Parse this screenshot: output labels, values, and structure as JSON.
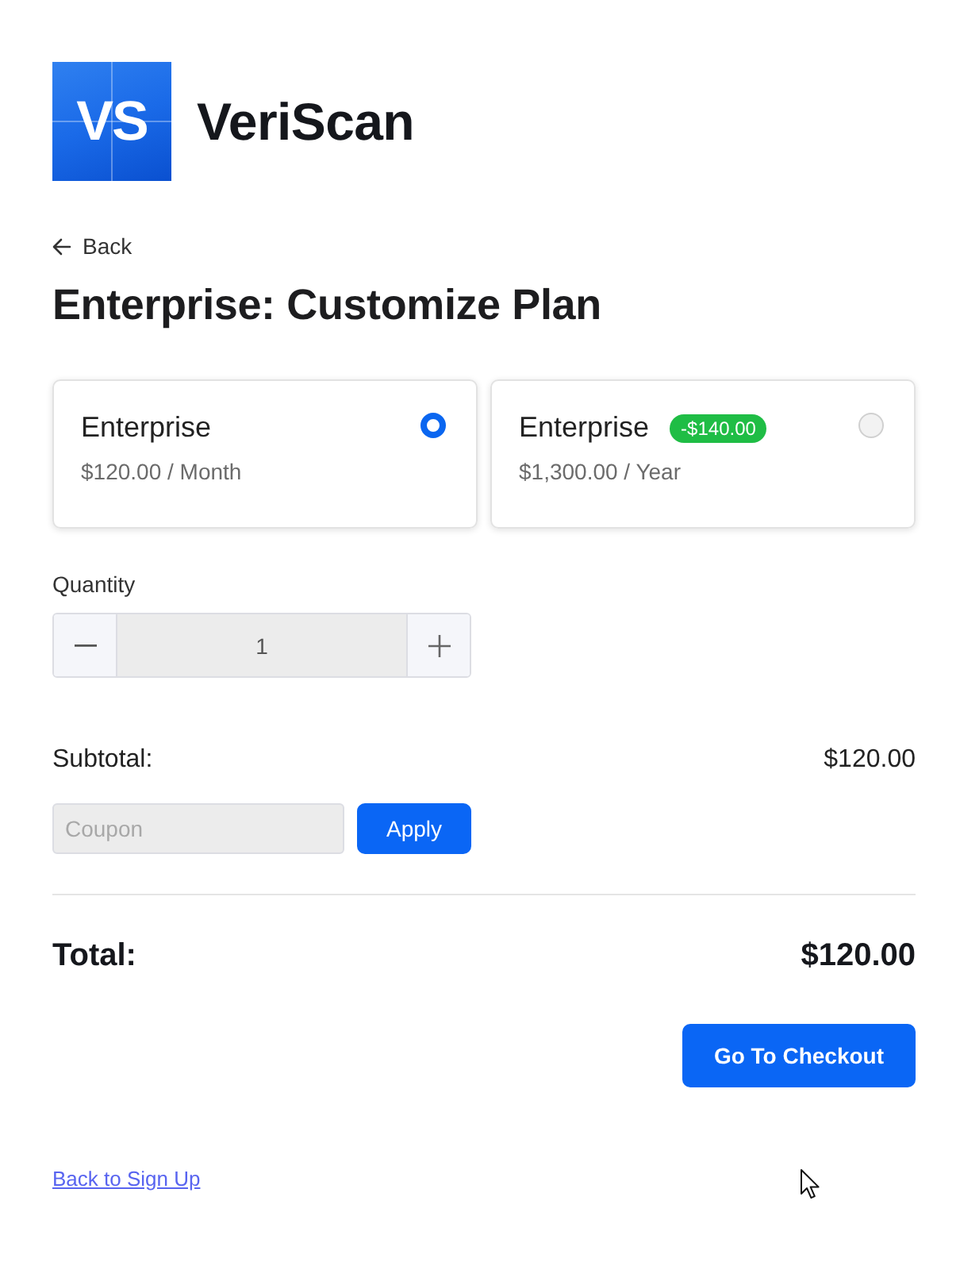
{
  "logo": {
    "mark": "VS",
    "name": "VeriScan"
  },
  "back_link": {
    "label": "Back"
  },
  "title": "Enterprise: Customize Plan",
  "plans": [
    {
      "name": "Enterprise",
      "price": "$120.00 / Month",
      "selected": true
    },
    {
      "name": "Enterprise",
      "badge": "-$140.00",
      "price": "$1,300.00 / Year",
      "selected": false
    }
  ],
  "quantity": {
    "label": "Quantity",
    "value": "1"
  },
  "subtotal": {
    "label": "Subtotal:",
    "value": "$120.00"
  },
  "coupon": {
    "placeholder": "Coupon",
    "button": "Apply"
  },
  "total": {
    "label": "Total:",
    "value": "$120.00"
  },
  "checkout_button": "Go To Checkout",
  "footer_link": "Back to Sign Up"
}
